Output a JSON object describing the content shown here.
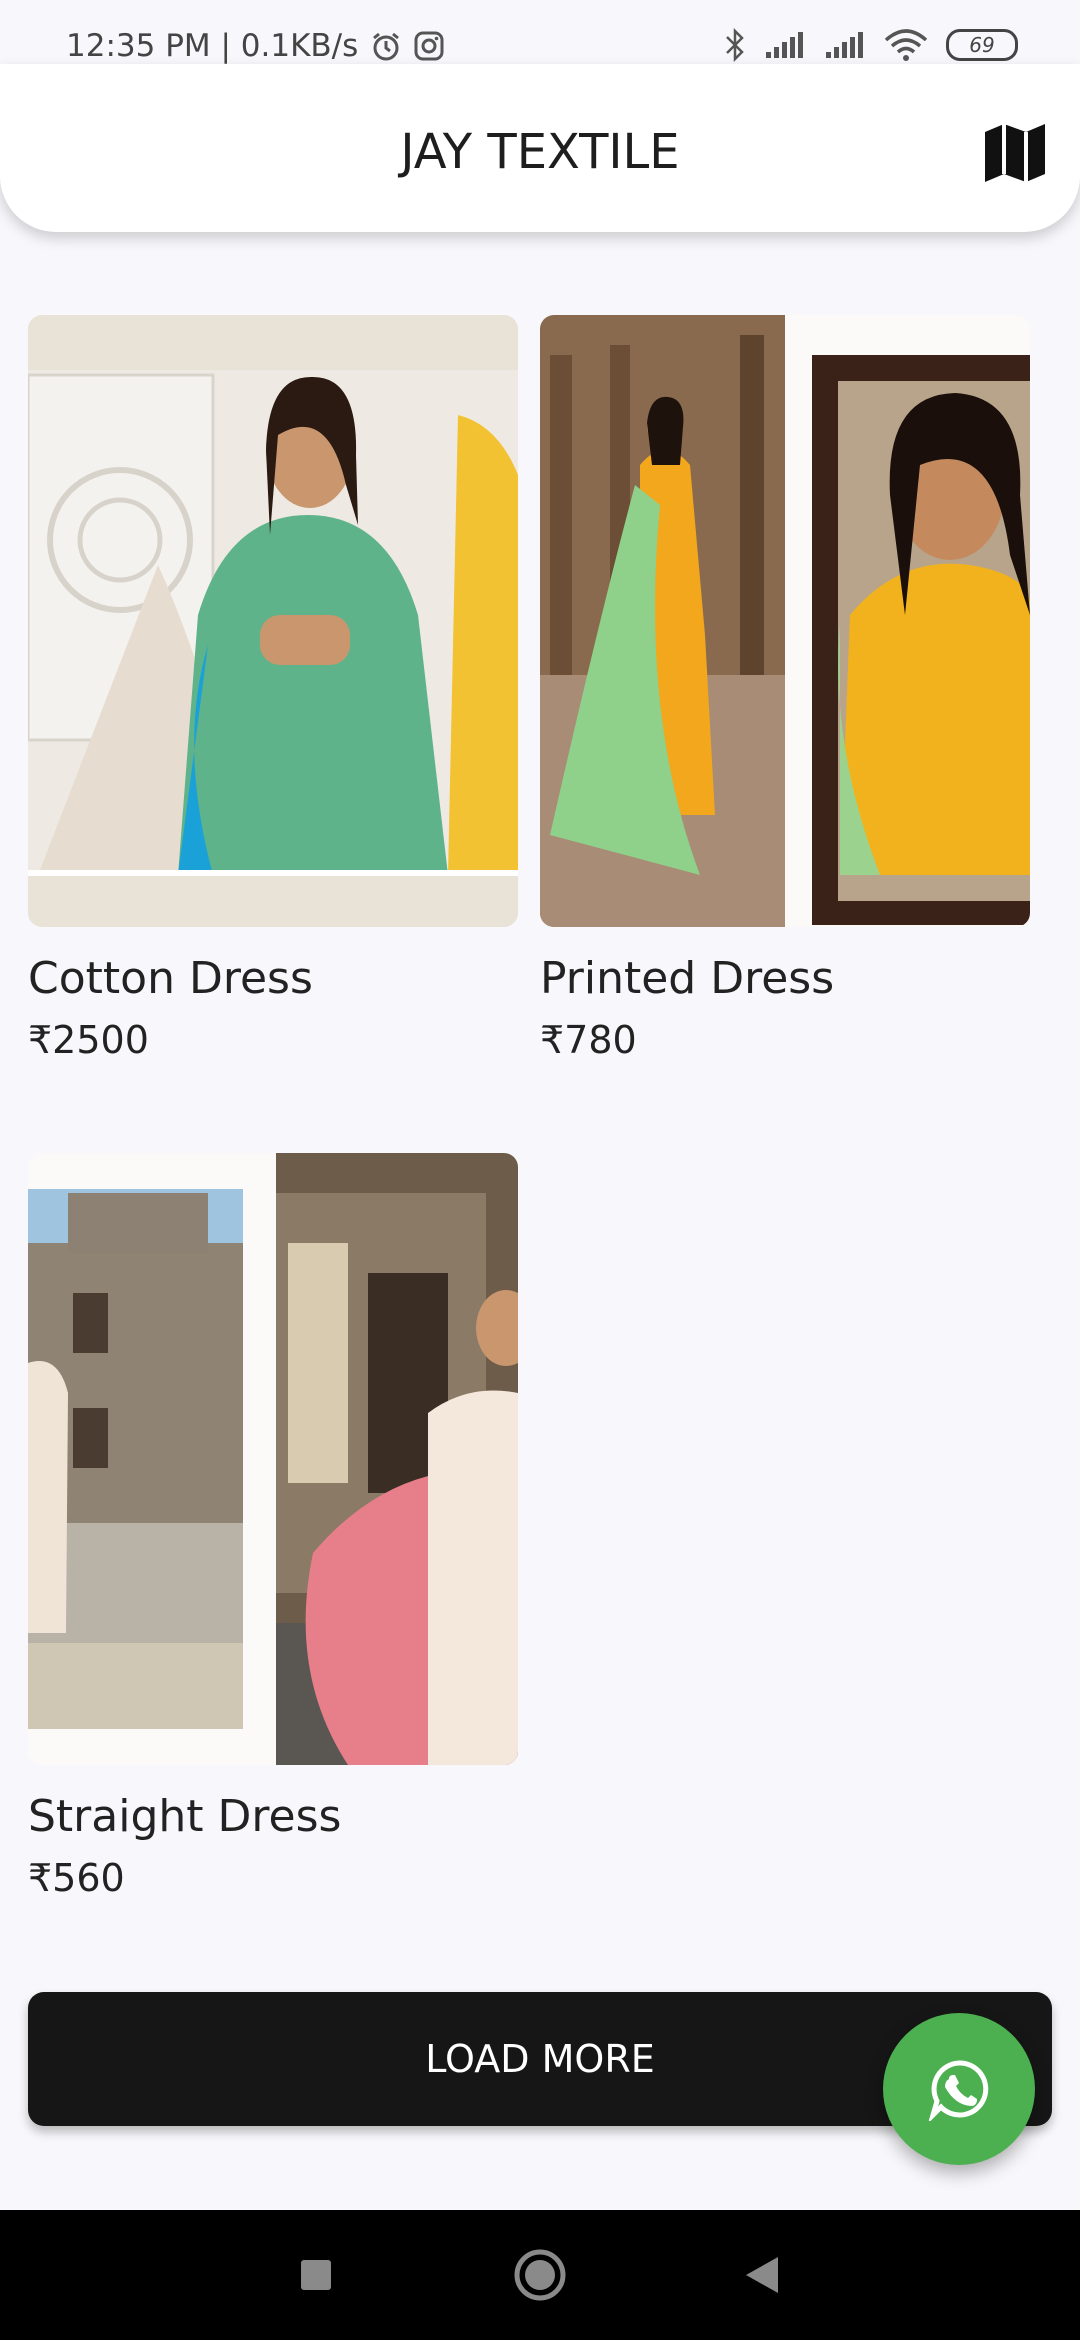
{
  "status_bar": {
    "time_speed": "12:35 PM | 0.1KB/s",
    "battery": "69"
  },
  "header": {
    "title": "JAY TEXTILE",
    "map_icon": "map-icon"
  },
  "products": [
    {
      "name": "Cotton Dress",
      "price": "₹2500"
    },
    {
      "name": "Printed Dress",
      "price": "₹780"
    },
    {
      "name": "Straight Dress",
      "price": "₹560"
    }
  ],
  "load_more_label": "LOAD MORE",
  "fab_icon": "whatsapp-icon",
  "nav": {
    "square": "recent-apps-icon",
    "circle": "home-icon",
    "triangle": "back-icon"
  },
  "colors": {
    "fab": "#4caf50",
    "button": "#161616",
    "background": "#f8f8fc"
  }
}
